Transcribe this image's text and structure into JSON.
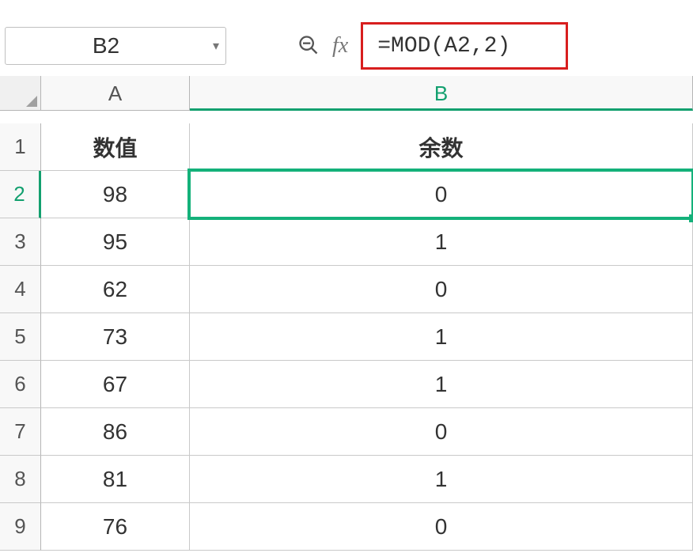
{
  "name_box": {
    "value": "B2"
  },
  "fx_label": "fx",
  "formula": "=MOD(A2,2)",
  "columns": {
    "A": "A",
    "B": "B"
  },
  "selected_col": "B",
  "selected_row": 2,
  "row_labels": [
    "1",
    "2",
    "3",
    "4",
    "5",
    "6",
    "7",
    "8",
    "9"
  ],
  "headers": {
    "A": "数值",
    "B": "余数"
  },
  "rows": [
    {
      "n": 2,
      "A": "98",
      "B": "0"
    },
    {
      "n": 3,
      "A": "95",
      "B": "1"
    },
    {
      "n": 4,
      "A": "62",
      "B": "0"
    },
    {
      "n": 5,
      "A": "73",
      "B": "1"
    },
    {
      "n": 6,
      "A": "67",
      "B": "1"
    },
    {
      "n": 7,
      "A": "86",
      "B": "0"
    },
    {
      "n": 8,
      "A": "81",
      "B": "1"
    },
    {
      "n": 9,
      "A": "76",
      "B": "0"
    }
  ],
  "chart_data": {
    "type": "table",
    "title": "MOD function results",
    "columns": [
      "数值",
      "余数"
    ],
    "data": [
      [
        98,
        0
      ],
      [
        95,
        1
      ],
      [
        62,
        0
      ],
      [
        73,
        1
      ],
      [
        67,
        1
      ],
      [
        86,
        0
      ],
      [
        81,
        1
      ],
      [
        76,
        0
      ]
    ]
  }
}
